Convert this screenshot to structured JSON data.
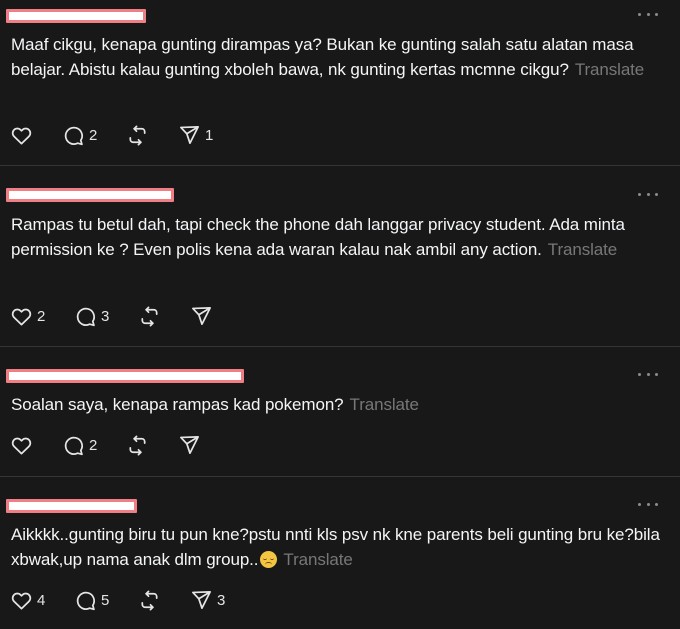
{
  "colors": {
    "background": "#181818",
    "divider": "#333638",
    "text": "#f3f5f7",
    "muted": "#777777",
    "redaction": "#ef7f85"
  },
  "posts": [
    {
      "text": "Maaf cikgu, kenapa gunting dirampas ya? Bukan ke gunting salah satu alatan masa belajar. Abistu kalau gunting xboleh bawa, nk gunting kertas mcmne cikgu?",
      "translate": "Translate",
      "likes": "",
      "replies": "2",
      "reposts": "",
      "shares": "1"
    },
    {
      "text": "Rampas tu betul dah, tapi check the phone dah langgar privacy student. Ada minta permission ke ? Even polis kena ada waran kalau nak ambil any action.",
      "translate": "Translate",
      "likes": "2",
      "replies": "3",
      "reposts": "",
      "shares": ""
    },
    {
      "text": "Soalan saya, kenapa rampas kad pokemon?",
      "translate": "Translate",
      "likes": "",
      "replies": "2",
      "reposts": "",
      "shares": ""
    },
    {
      "text": "Aikkkk..gunting biru tu pun kne?pstu nnti kls psv nk kne parents beli gunting bru ke?bila xbwak,up nama anak dlm group..",
      "emoji": "pensive-face-emoji",
      "translate": "Translate",
      "likes": "4",
      "replies": "5",
      "reposts": "",
      "shares": "3"
    }
  ],
  "icons": {
    "like": "heart-icon",
    "reply": "comment-bubble-icon",
    "repost": "repost-icon",
    "share": "send-icon",
    "more": "more-options-icon"
  }
}
